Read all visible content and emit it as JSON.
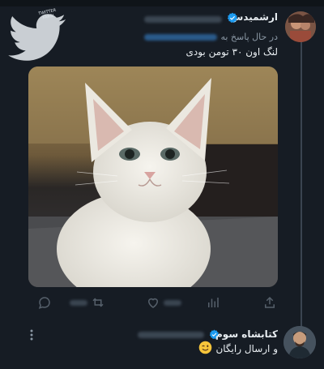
{
  "watermark": {
    "label": "TWITTER FARSI",
    "icon": "twitter-bird-icon"
  },
  "tweet1": {
    "author_name": "ارشمیدس",
    "verified_icon": "verified-badge-icon",
    "reply_label": "در حال پاسخ به",
    "text": "لنگ اون ۳۰ تومن بودی",
    "media": "white-kitten-photo",
    "actions": [
      "reply-icon",
      "retweet-icon",
      "like-icon",
      "views-icon",
      "share-icon"
    ]
  },
  "tweet2": {
    "author_name": "کتابشاه سوم",
    "verified_icon": "verified-badge-icon",
    "text": "و ارسال رایگان",
    "emoji": "winking-face-emoji"
  },
  "colors": {
    "background": "#161c24",
    "text_primary": "#e8edf1",
    "text_secondary": "#8b98a5",
    "verified_blue": "#1d9bf0",
    "thread_line": "#3a4450"
  }
}
